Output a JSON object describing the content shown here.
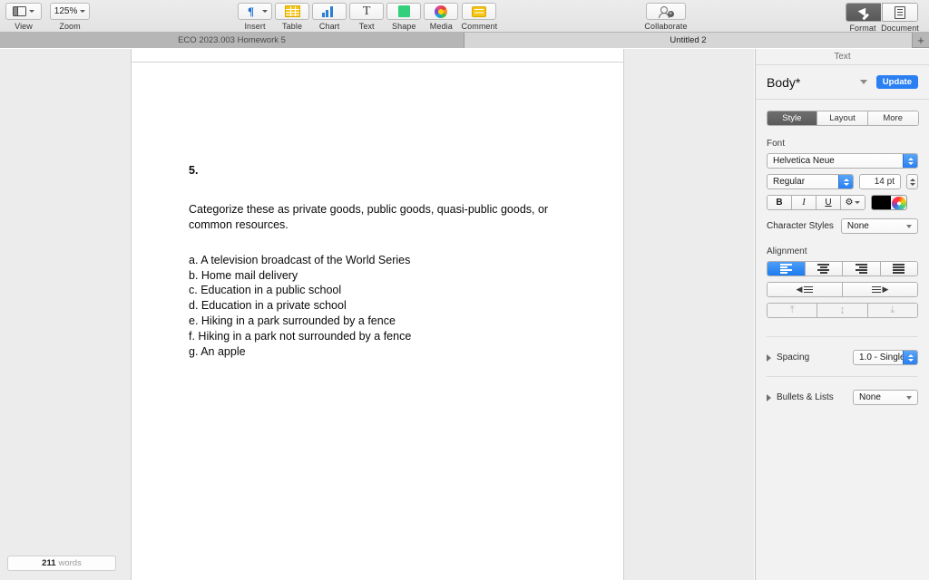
{
  "toolbar": {
    "view": {
      "label": "View",
      "icon": "sidebar-icon"
    },
    "zoom": {
      "label": "Zoom",
      "value": "125%"
    },
    "insert": {
      "label": "Insert",
      "icon": "pilcrow-icon"
    },
    "table": {
      "label": "Table",
      "icon": "table-icon"
    },
    "chart": {
      "label": "Chart",
      "icon": "bar-chart-icon"
    },
    "text": {
      "label": "Text",
      "icon": "text-t-icon"
    },
    "shape": {
      "label": "Shape",
      "icon": "square-shape-icon"
    },
    "media": {
      "label": "Media",
      "icon": "color-wheel-media-icon"
    },
    "comment": {
      "label": "Comment",
      "icon": "comment-note-icon"
    },
    "collaborate": {
      "label": "Collaborate",
      "icon": "add-person-icon"
    },
    "format": {
      "label": "Format",
      "icon": "paintbrush-icon",
      "active": true
    },
    "document": {
      "label": "Document",
      "icon": "document-page-icon",
      "active": false
    }
  },
  "tabs": {
    "items": [
      {
        "label": "ECO 2023.003 Homework 5",
        "active": false
      },
      {
        "label": "Untitled 2",
        "active": true
      }
    ],
    "add_label": "+"
  },
  "document": {
    "number": "5.",
    "prompt": "Categorize these as private goods, public goods, quasi-public goods, or common resources.",
    "items": [
      "a. A television broadcast of the World Series",
      "b. Home mail delivery",
      "c. Education in a public school",
      "d. Education in a private school",
      "e. Hiking in a park surrounded by a fence",
      "f. Hiking in a park not surrounded by a fence",
      "g. An apple"
    ]
  },
  "status": {
    "word_count": "211",
    "word_label": "words"
  },
  "inspector": {
    "title": "Text",
    "paragraph_style": "Body*",
    "update_label": "Update",
    "tabs": [
      {
        "label": "Style",
        "active": true
      },
      {
        "label": "Layout",
        "active": false
      },
      {
        "label": "More",
        "active": false
      }
    ],
    "font": {
      "section_label": "Font",
      "family": "Helvetica Neue",
      "weight": "Regular",
      "size": "14 pt",
      "bold_label": "B",
      "italic_label": "I",
      "underline_label": "U",
      "options_icon": "gear-icon",
      "color": "#000000",
      "color_wheel_icon": "color-wheel-icon"
    },
    "character_styles": {
      "label": "Character Styles",
      "value": "None"
    },
    "alignment": {
      "section_label": "Alignment",
      "buttons": [
        {
          "name": "align-left",
          "active": true
        },
        {
          "name": "align-center",
          "active": false
        },
        {
          "name": "align-right",
          "active": false
        },
        {
          "name": "align-justify",
          "active": false
        }
      ],
      "indent_decrease_icon": "decrease-indent-icon",
      "indent_increase_icon": "increase-indent-icon",
      "valign": [
        {
          "name": "align-top",
          "glyph": "⤒",
          "enabled": false
        },
        {
          "name": "align-middle",
          "glyph": "↨",
          "enabled": false
        },
        {
          "name": "align-bottom",
          "glyph": "⤓",
          "enabled": false
        }
      ]
    },
    "spacing": {
      "label": "Spacing",
      "value": "1.0 - Single"
    },
    "bullets": {
      "label": "Bullets & Lists",
      "value": "None"
    }
  },
  "colors": {
    "accent": "#2a7ff2",
    "toolbar_bg": "#e8e8e8",
    "canvas_bg": "#ececec",
    "inspector_bg": "#f2f2f2"
  }
}
